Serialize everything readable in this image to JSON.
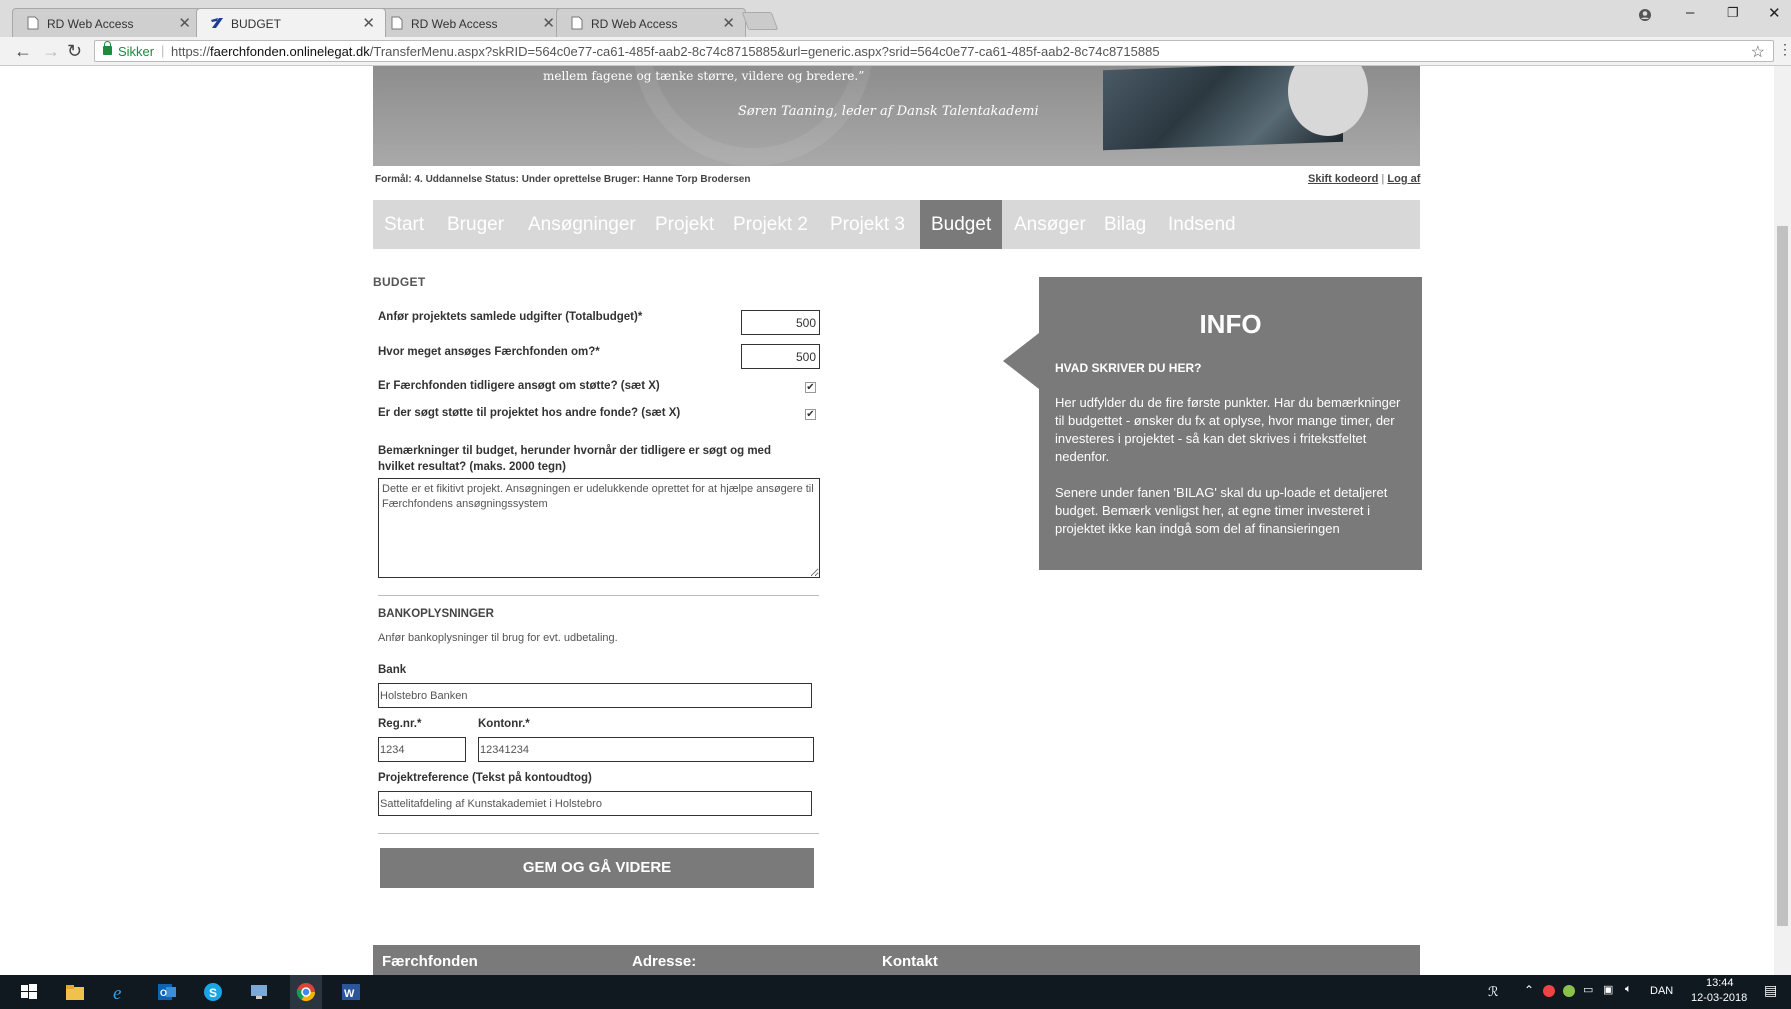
{
  "browser": {
    "tabs": [
      {
        "title": "RD Web Access",
        "icon": "page-icon",
        "active": false
      },
      {
        "title": "BUDGET",
        "icon": "brand-icon",
        "active": true
      },
      {
        "title": "RD Web Access",
        "icon": "page-icon",
        "active": false
      },
      {
        "title": "RD Web Access",
        "icon": "page-icon",
        "active": false
      }
    ],
    "close_glyph": "✕",
    "secure_label": "Sikker",
    "url_prefix": "https://",
    "url_host": "faerchfonden.onlinelegat.dk",
    "url_path": "/TransferMenu.aspx?skRID=564c0e77-ca61-485f-aab2-8c74c8715885&url=generic.aspx?srid=564c0e77-ca61-485f-aab2-8c74c8715885"
  },
  "banner": {
    "quote_line": "mellem fagene og tænke større, vildere og bredere.”",
    "quote_author": "Søren Taaning, leder af Dansk Talentakademi"
  },
  "status_line": "Formål: 4. Uddannelse Status: Under oprettelse Bruger: Hanne Torp Brodersen",
  "top_links": {
    "change_password": "Skift kodeord",
    "logout": "Log af"
  },
  "menu": [
    {
      "label": "Start",
      "active": false
    },
    {
      "label": "Bruger",
      "active": false
    },
    {
      "label": "Ansøgninger",
      "active": false
    },
    {
      "label": "Projekt",
      "active": false
    },
    {
      "label": "Projekt 2",
      "active": false
    },
    {
      "label": "Projekt 3",
      "active": false
    },
    {
      "label": "Budget",
      "active": true
    },
    {
      "label": "Ansøger",
      "active": false
    },
    {
      "label": "Bilag",
      "active": false
    },
    {
      "label": "Indsend",
      "active": false
    }
  ],
  "form": {
    "section_title": "BUDGET",
    "total_budget_label": "Anfør projektets samlede udgifter (Totalbudget)*",
    "total_budget_value": "500",
    "applied_amount_label": "Hvor meget ansøges Færchfonden om?*",
    "applied_amount_value": "500",
    "previously_applied_label": "Er Færchfonden tidligere ansøgt om støtte? (sæt X)",
    "previously_applied_checked": true,
    "other_funds_label": "Er der søgt støtte til projektet hos andre fonde? (sæt X)",
    "other_funds_checked": true,
    "remarks_label": "Bemærkninger til budget, herunder hvornår der tidligere er søgt og med hvilket resultat? (maks. 2000 tegn)",
    "remarks_value": "Dette er et fikitivt projekt. Ansøgningen er udelukkende oprettet for at hjælpe ansøgere til Færchfondens ansøgningssystem",
    "check_glyph": "✔"
  },
  "bank": {
    "title": "BANKOPLYSNINGER",
    "description": "Anfør bankoplysninger til brug for evt. udbetaling.",
    "bank_label": "Bank",
    "bank_value": "Holstebro Banken",
    "reg_label": "Reg.nr.*",
    "reg_value": "1234",
    "account_label": "Kontonr.*",
    "account_value": "12341234",
    "reference_label": "Projektreference (Tekst på kontoudtog)",
    "reference_value": "Sattelitafdeling af Kunstakademiet i Holstebro"
  },
  "submit_label": "GEM OG GÅ VIDERE",
  "info": {
    "title": "INFO",
    "subtitle": "HVAD SKRIVER DU HER?",
    "paragraph1": "Her udfylder du de fire første punkter. Har du bemærkninger til budgettet - ønsker du fx at oplyse, hvor mange timer, der investeres i projektet - så kan det skrives i fritekstfeltet nedenfor.",
    "paragraph2": "Senere under fanen 'BILAG' skal du up-loade et detaljeret budget. Bemærk venligst her, at egne timer investeret i projektet ikke kan indgå som del af finansieringen"
  },
  "footer": {
    "col1": "Færchfonden",
    "col2": "Adresse:",
    "col3": "Kontakt"
  },
  "taskbar": {
    "language": "DAN",
    "time": "13:44",
    "date": "12-03-2018"
  },
  "colors": {
    "accent_gray": "#7a7a7a",
    "menu_bg": "#d8d8d8",
    "secure_green": "#1a8d3c"
  }
}
